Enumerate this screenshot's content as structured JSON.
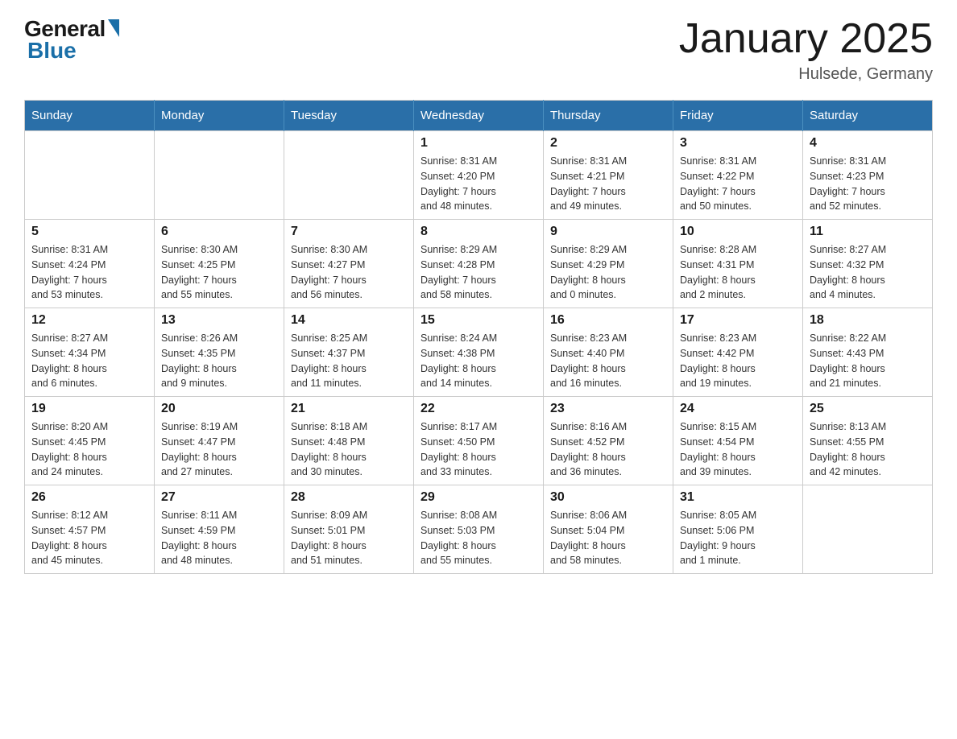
{
  "logo": {
    "general": "General",
    "blue": "Blue"
  },
  "title": "January 2025",
  "location": "Hulsede, Germany",
  "days_of_week": [
    "Sunday",
    "Monday",
    "Tuesday",
    "Wednesday",
    "Thursday",
    "Friday",
    "Saturday"
  ],
  "weeks": [
    [
      {
        "day": "",
        "info": ""
      },
      {
        "day": "",
        "info": ""
      },
      {
        "day": "",
        "info": ""
      },
      {
        "day": "1",
        "info": "Sunrise: 8:31 AM\nSunset: 4:20 PM\nDaylight: 7 hours\nand 48 minutes."
      },
      {
        "day": "2",
        "info": "Sunrise: 8:31 AM\nSunset: 4:21 PM\nDaylight: 7 hours\nand 49 minutes."
      },
      {
        "day": "3",
        "info": "Sunrise: 8:31 AM\nSunset: 4:22 PM\nDaylight: 7 hours\nand 50 minutes."
      },
      {
        "day": "4",
        "info": "Sunrise: 8:31 AM\nSunset: 4:23 PM\nDaylight: 7 hours\nand 52 minutes."
      }
    ],
    [
      {
        "day": "5",
        "info": "Sunrise: 8:31 AM\nSunset: 4:24 PM\nDaylight: 7 hours\nand 53 minutes."
      },
      {
        "day": "6",
        "info": "Sunrise: 8:30 AM\nSunset: 4:25 PM\nDaylight: 7 hours\nand 55 minutes."
      },
      {
        "day": "7",
        "info": "Sunrise: 8:30 AM\nSunset: 4:27 PM\nDaylight: 7 hours\nand 56 minutes."
      },
      {
        "day": "8",
        "info": "Sunrise: 8:29 AM\nSunset: 4:28 PM\nDaylight: 7 hours\nand 58 minutes."
      },
      {
        "day": "9",
        "info": "Sunrise: 8:29 AM\nSunset: 4:29 PM\nDaylight: 8 hours\nand 0 minutes."
      },
      {
        "day": "10",
        "info": "Sunrise: 8:28 AM\nSunset: 4:31 PM\nDaylight: 8 hours\nand 2 minutes."
      },
      {
        "day": "11",
        "info": "Sunrise: 8:27 AM\nSunset: 4:32 PM\nDaylight: 8 hours\nand 4 minutes."
      }
    ],
    [
      {
        "day": "12",
        "info": "Sunrise: 8:27 AM\nSunset: 4:34 PM\nDaylight: 8 hours\nand 6 minutes."
      },
      {
        "day": "13",
        "info": "Sunrise: 8:26 AM\nSunset: 4:35 PM\nDaylight: 8 hours\nand 9 minutes."
      },
      {
        "day": "14",
        "info": "Sunrise: 8:25 AM\nSunset: 4:37 PM\nDaylight: 8 hours\nand 11 minutes."
      },
      {
        "day": "15",
        "info": "Sunrise: 8:24 AM\nSunset: 4:38 PM\nDaylight: 8 hours\nand 14 minutes."
      },
      {
        "day": "16",
        "info": "Sunrise: 8:23 AM\nSunset: 4:40 PM\nDaylight: 8 hours\nand 16 minutes."
      },
      {
        "day": "17",
        "info": "Sunrise: 8:23 AM\nSunset: 4:42 PM\nDaylight: 8 hours\nand 19 minutes."
      },
      {
        "day": "18",
        "info": "Sunrise: 8:22 AM\nSunset: 4:43 PM\nDaylight: 8 hours\nand 21 minutes."
      }
    ],
    [
      {
        "day": "19",
        "info": "Sunrise: 8:20 AM\nSunset: 4:45 PM\nDaylight: 8 hours\nand 24 minutes."
      },
      {
        "day": "20",
        "info": "Sunrise: 8:19 AM\nSunset: 4:47 PM\nDaylight: 8 hours\nand 27 minutes."
      },
      {
        "day": "21",
        "info": "Sunrise: 8:18 AM\nSunset: 4:48 PM\nDaylight: 8 hours\nand 30 minutes."
      },
      {
        "day": "22",
        "info": "Sunrise: 8:17 AM\nSunset: 4:50 PM\nDaylight: 8 hours\nand 33 minutes."
      },
      {
        "day": "23",
        "info": "Sunrise: 8:16 AM\nSunset: 4:52 PM\nDaylight: 8 hours\nand 36 minutes."
      },
      {
        "day": "24",
        "info": "Sunrise: 8:15 AM\nSunset: 4:54 PM\nDaylight: 8 hours\nand 39 minutes."
      },
      {
        "day": "25",
        "info": "Sunrise: 8:13 AM\nSunset: 4:55 PM\nDaylight: 8 hours\nand 42 minutes."
      }
    ],
    [
      {
        "day": "26",
        "info": "Sunrise: 8:12 AM\nSunset: 4:57 PM\nDaylight: 8 hours\nand 45 minutes."
      },
      {
        "day": "27",
        "info": "Sunrise: 8:11 AM\nSunset: 4:59 PM\nDaylight: 8 hours\nand 48 minutes."
      },
      {
        "day": "28",
        "info": "Sunrise: 8:09 AM\nSunset: 5:01 PM\nDaylight: 8 hours\nand 51 minutes."
      },
      {
        "day": "29",
        "info": "Sunrise: 8:08 AM\nSunset: 5:03 PM\nDaylight: 8 hours\nand 55 minutes."
      },
      {
        "day": "30",
        "info": "Sunrise: 8:06 AM\nSunset: 5:04 PM\nDaylight: 8 hours\nand 58 minutes."
      },
      {
        "day": "31",
        "info": "Sunrise: 8:05 AM\nSunset: 5:06 PM\nDaylight: 9 hours\nand 1 minute."
      },
      {
        "day": "",
        "info": ""
      }
    ]
  ]
}
